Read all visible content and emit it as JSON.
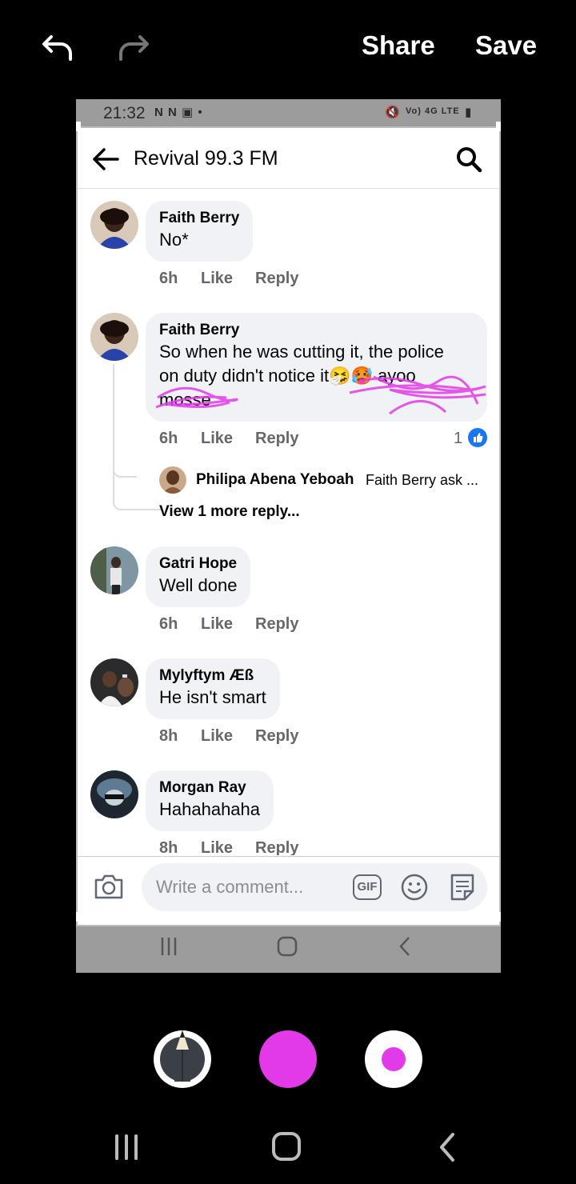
{
  "editor": {
    "share_label": "Share",
    "save_label": "Save",
    "icons": [
      "undo-icon",
      "redo-icon",
      "pen-tool-icon",
      "color-picker",
      "brush-size-icon"
    ],
    "pen_color": "#e23ae8"
  },
  "status_bar": {
    "time": "21:32",
    "right_icons": "Vo) 4G LTE"
  },
  "header": {
    "title": "Revival 99.3 FM"
  },
  "comments": [
    {
      "name": "Faith Berry",
      "text": "No*",
      "time": "6h",
      "like": "Like",
      "reply": "Reply"
    },
    {
      "name": "Faith Berry",
      "text_line1": "So when he was cutting it, the police",
      "text_line2": "on duty  didn't notice it🤧🥵 ayoo",
      "text_line3": "mosse",
      "time": "6h",
      "like": "Like",
      "reply": "Reply",
      "like_count": "1"
    },
    {
      "name": "Gatri Hope",
      "text": "Well done",
      "time": "6h",
      "like": "Like",
      "reply": "Reply"
    },
    {
      "name": "Mylyftym Æß",
      "text": "He isn't smart",
      "time": "8h",
      "like": "Like",
      "reply": "Reply"
    },
    {
      "name": "Morgan Ray",
      "text": "Hahahahaha",
      "time": "8h",
      "like": "Like",
      "reply": "Reply"
    }
  ],
  "reply_preview": {
    "name": "Philipa Abena Yeboah",
    "text": "Faith Berry ask ...",
    "view_more": "View 1 more reply..."
  },
  "composer": {
    "placeholder": "Write a comment...",
    "gif_label": "GIF"
  }
}
